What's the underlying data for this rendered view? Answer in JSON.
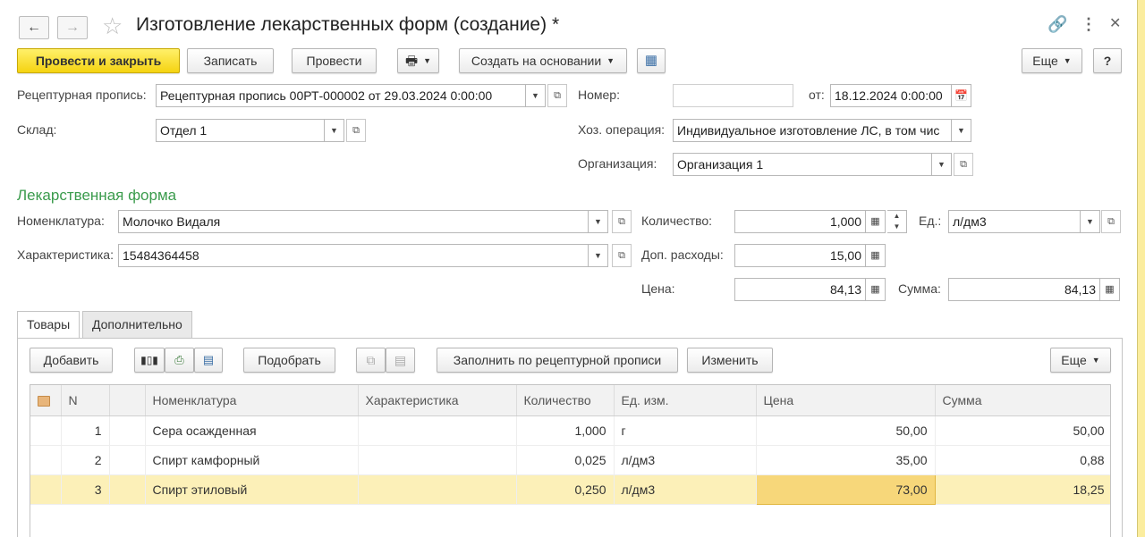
{
  "window": {
    "title": "Изготовление лекарственных форм (создание) *",
    "icons": {
      "back": "arrow-left-icon",
      "forward": "arrow-right-icon",
      "favorite": "star-icon",
      "link": "link-icon",
      "menu": "more-vertical-icon",
      "close": "close-icon"
    }
  },
  "toolbar": {
    "post_close": "Провести и закрыть",
    "save": "Записать",
    "post": "Провести",
    "create_based_on": "Создать на основании",
    "more": "Еще",
    "help": "?"
  },
  "form": {
    "prescription_label": "Рецептурная пропись:",
    "prescription_value": "Рецептурная пропись 00РТ-000002 от 29.03.2024 0:00:00",
    "number_label": "Номер:",
    "number_value": "",
    "date_label": "от:",
    "date_value": "18.12.2024  0:00:00",
    "warehouse_label": "Склад:",
    "warehouse_value": "Отдел 1",
    "operation_label": "Хоз. операция:",
    "operation_value": "Индивидуальное изготовление ЛС, в том чис",
    "organization_label": "Организация:",
    "organization_value": "Организация 1"
  },
  "dosage_form": {
    "section_title": "Лекарственная форма",
    "nomenclature_label": "Номенклатура:",
    "nomenclature_value": "Молочко Видаля",
    "characteristic_label": "Характеристика:",
    "characteristic_value": "15484364458",
    "quantity_label": "Количество:",
    "quantity_value": "1,000",
    "unit_label": "Ед.:",
    "unit_value": "л/дм3",
    "extra_costs_label": "Доп. расходы:",
    "extra_costs_value": "15,00",
    "price_label": "Цена:",
    "price_value": "84,13",
    "sum_label": "Сумма:",
    "sum_value": "84,13"
  },
  "tabs": [
    {
      "label": "Товары",
      "active": true
    },
    {
      "label": "Дополнительно",
      "active": false
    }
  ],
  "goods_toolbar": {
    "add": "Добавить",
    "pick": "Подобрать",
    "fill_by_prescription": "Заполнить по рецептурной прописи",
    "change": "Изменить",
    "more": "Еще"
  },
  "table": {
    "columns": [
      "",
      "N",
      "",
      "Номенклатура",
      "Характеристика",
      "Количество",
      "Ед. изм.",
      "Цена",
      "Сумма"
    ],
    "rows": [
      {
        "n": "1",
        "nomenclature": "Сера осажденная",
        "characteristic": "",
        "quantity": "1,000",
        "unit": "г",
        "price": "50,00",
        "sum": "50,00"
      },
      {
        "n": "2",
        "nomenclature": "Спирт камфорный",
        "characteristic": "",
        "quantity": "0,025",
        "unit": "л/дм3",
        "price": "35,00",
        "sum": "0,88"
      },
      {
        "n": "3",
        "nomenclature": "Спирт этиловый",
        "characteristic": "",
        "quantity": "0,250",
        "unit": "л/дм3",
        "price": "73,00",
        "sum": "18,25"
      }
    ]
  },
  "colors": {
    "accent_yellow": "#f5d311",
    "section_green": "#3a9b4c",
    "selected_row": "#fcf0b8",
    "background_frame": "#fbed9e"
  }
}
